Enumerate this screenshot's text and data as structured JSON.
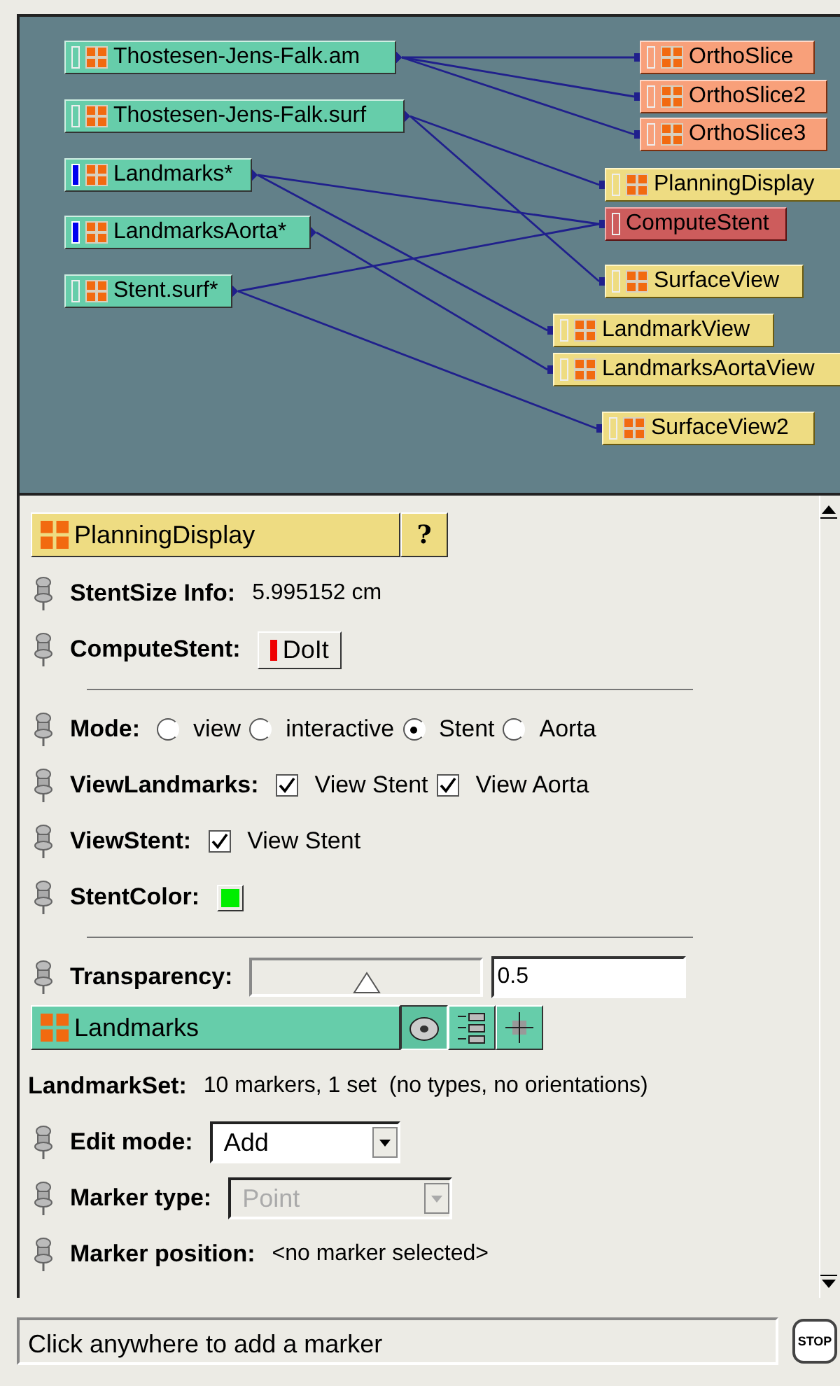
{
  "network": {
    "nodes": [
      {
        "label": "Thostesen-Jens-Falk.am",
        "kind": "data",
        "selected": false
      },
      {
        "label": "Thostesen-Jens-Falk.surf",
        "kind": "data",
        "selected": false
      },
      {
        "label": "Landmarks*",
        "kind": "data",
        "selected": true
      },
      {
        "label": "LandmarksAorta*",
        "kind": "data",
        "selected": true
      },
      {
        "label": "Stent.surf*",
        "kind": "data",
        "selected": false
      },
      {
        "label": "OrthoSlice",
        "kind": "slice",
        "selected": false
      },
      {
        "label": "OrthoSlice2",
        "kind": "slice",
        "selected": false
      },
      {
        "label": "OrthoSlice3",
        "kind": "slice",
        "selected": false
      },
      {
        "label": "PlanningDisplay",
        "kind": "display",
        "selected": false
      },
      {
        "label": "ComputeStent",
        "kind": "compute",
        "selected": false
      },
      {
        "label": "SurfaceView",
        "kind": "display",
        "selected": false
      },
      {
        "label": "LandmarkView",
        "kind": "display",
        "selected": false
      },
      {
        "label": "LandmarksAortaView",
        "kind": "display",
        "selected": false
      },
      {
        "label": "SurfaceView2",
        "kind": "display",
        "selected": false
      }
    ]
  },
  "properties": [
    {
      "kind": "display_header",
      "title": "PlanningDisplay",
      "help": "?"
    },
    {
      "kind": "info",
      "label": "StentSize Info:",
      "value": "5.995152 cm"
    },
    {
      "kind": "button",
      "label": "ComputeStent:",
      "button": "DoIt"
    },
    {
      "kind": "divider"
    },
    {
      "kind": "radio",
      "label": "Mode:",
      "options": [
        {
          "label": "view",
          "selected": false
        },
        {
          "label": "interactive",
          "selected": false
        },
        {
          "label": "Stent",
          "selected": true
        },
        {
          "label": "Aorta",
          "selected": false
        }
      ]
    },
    {
      "kind": "checks",
      "label": "ViewLandmarks:",
      "options": [
        {
          "label": "View Stent",
          "checked": true
        },
        {
          "label": "View Aorta",
          "checked": true
        }
      ]
    },
    {
      "kind": "checks",
      "label": "ViewStent:",
      "options": [
        {
          "label": "View Stent",
          "checked": true
        }
      ]
    },
    {
      "kind": "color",
      "label": "StentColor:",
      "color": "#00ee00"
    },
    {
      "kind": "divider"
    },
    {
      "kind": "slider",
      "label": "Transparency:",
      "level": 0.5,
      "value": "0.5"
    },
    {
      "kind": "data_header",
      "title": "Landmarks"
    },
    {
      "kind": "setinfo",
      "label": "LandmarkSet:",
      "value": "10 markers, 1 set  (no types, no orientations)"
    },
    {
      "kind": "dropdown",
      "label": "Edit mode:",
      "value": "Add",
      "disabled": false
    },
    {
      "kind": "dropdown",
      "label": "Marker type:",
      "value": "Point",
      "disabled": true
    },
    {
      "kind": "info",
      "label": "Marker position:",
      "value": "<no marker selected>"
    }
  ],
  "status_bar": {
    "message": "Click anywhere to add a marker",
    "stop": "STOP"
  }
}
